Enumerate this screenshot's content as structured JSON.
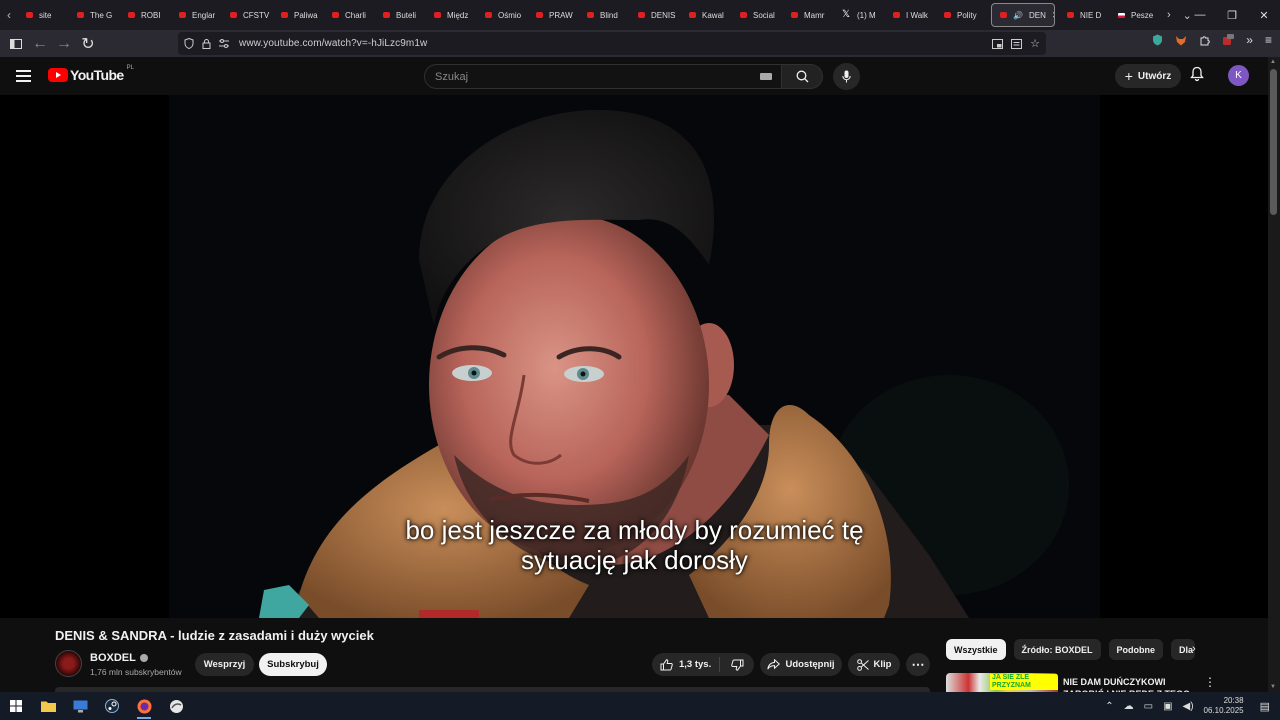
{
  "browser": {
    "tabs": [
      {
        "label": "site",
        "icon": "youtube"
      },
      {
        "label": "The G",
        "icon": "youtube"
      },
      {
        "label": "ROBI",
        "icon": "youtube"
      },
      {
        "label": "Englar",
        "icon": "youtube"
      },
      {
        "label": "CFSTV",
        "icon": "youtube"
      },
      {
        "label": "Paliwa",
        "icon": "youtube"
      },
      {
        "label": "Charli",
        "icon": "youtube"
      },
      {
        "label": "Buteli",
        "icon": "youtube"
      },
      {
        "label": "Międz",
        "icon": "youtube"
      },
      {
        "label": "Ośmio",
        "icon": "youtube"
      },
      {
        "label": "PRAW",
        "icon": "youtube"
      },
      {
        "label": "Blind",
        "icon": "youtube"
      },
      {
        "label": "DENIS",
        "icon": "youtube"
      },
      {
        "label": "Kawal",
        "icon": "youtube"
      },
      {
        "label": "Social",
        "icon": "youtube"
      },
      {
        "label": "Mamr",
        "icon": "youtube"
      },
      {
        "label": "(1) M",
        "icon": "x"
      },
      {
        "label": "I Walk",
        "icon": "youtube"
      },
      {
        "label": "Polity",
        "icon": "youtube"
      }
    ],
    "active_tab": {
      "label": "DEN",
      "icon": "youtube"
    },
    "tabs_after": [
      {
        "label": "NIE D",
        "icon": "youtube"
      },
      {
        "label": "Pesze",
        "icon": "poland"
      }
    ],
    "url": "www.youtube.com/watch?v=-hJiLzc9m1w"
  },
  "youtube": {
    "logo_text": "YouTube",
    "country_code": "PL",
    "search_placeholder": "Szukaj",
    "create_label": "Utwórz",
    "avatar_letter": "K",
    "subtitles": [
      "bo jest jeszcze za młody by rozumieć tę",
      "sytuację jak dorosły"
    ],
    "video_title": "DENIS & SANDRA - ludzie z zasadami i duży wyciek",
    "channel_name": "BOXDEL",
    "subscriber_count": "1,76 mln subskrybentów",
    "support_label": "Wesprzyj",
    "subscribe_label": "Subskrybuj",
    "likes": "1,3 tys.",
    "share_label": "Udostępnij",
    "clip_label": "Klip",
    "chips": [
      "Wszystkie",
      "Źródło: BOXDEL",
      "Podobne",
      "Dla"
    ],
    "recommended": {
      "title": "NIE DAM DUŃCZYKOWI ZAROBIĆ I NIE BĘDĘ Z TEGO",
      "thumb_text": "JA SIE ZLE PRZYZNAM"
    },
    "accent_color": "#ff0000"
  },
  "taskbar": {
    "time": "20:38",
    "date": "06.10.2025"
  }
}
